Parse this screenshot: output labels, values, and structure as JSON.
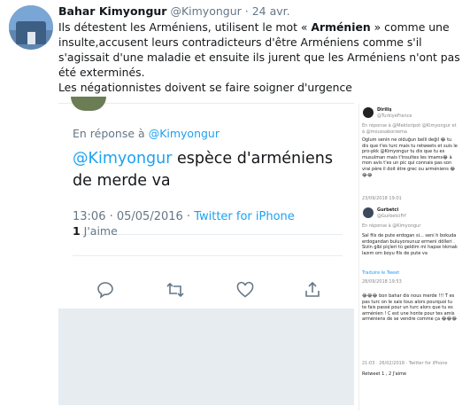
{
  "tweet": {
    "display_name": "Bahar Kimyongur",
    "handle": "@Kimyongur",
    "separator": "·",
    "date": "24 avr.",
    "text_part1": "Ils détestent les Arméniens, utilisent le mot « ",
    "text_bold": "Arménien",
    "text_part2": " » comme une insulte,accusent leurs contradicteurs d'être Arméniens comme s'il s'agissait d'une maladie et ensuite ils jurent que les Arméniens n'ont pas été exterminés.",
    "text_line2": "Les négationnistes doivent se faire soigner d'urgence"
  },
  "embedded": {
    "reply_prefix": "En réponse à",
    "reply_mention": "@Kimyongur",
    "body_mention": "@Kimyongur",
    "body_text": " espèce d'arméniens de merde va",
    "time": "13:06 · 05/05/2016 · ",
    "source": "Twitter for iPhone",
    "likes_count": "1",
    "likes_label": " J'aime",
    "actions": [
      "reply-icon",
      "retweet-icon",
      "like-icon",
      "share-icon"
    ]
  },
  "screenshot": {
    "user1_name": "Diriliş",
    "user1_handle": "@TurkiyeFrance",
    "user1_reply": "En réponse à @Mektoripot @Kimyongur et à @moussaborzema",
    "user1_text": "Oglum senin ne olduğun belli değil 😂 tu dis que t'es turc mais tu retweets et suis le pro-pkk @Kimyongur tu dis que tu es musulman mais t'insultes les imams😂 à mon avis t'es un pic qui connais pas son vrai père il doit être grec ou arméniens 😂😂😂",
    "user1_date": "23/09/2018 19:01",
    "user2_name": "Gurbetci",
    "user2_handle": "@GurbetciFrf",
    "user2_reply": "En réponse à @Kimyongur",
    "user2_text": "Sal fils de pute erdogan si... seni h bokuda erdogandan buluyorsunuz ermeni dölleri . Sizin gibi piçleri tü geldim mi hapse tıkmak lazım om boyu fils de pute va",
    "user2_translate": "Traduire le Tweet",
    "user2_date": "28/09/2018 19:53",
    "user3_text": "😂😂😂 bon bahar dis nous merde !!! T es pas turc on le sais tous alors pourquoi tu te fais passé pour un turc alors que tu es arménien ! C est une honte pour tes amis arméniens de se vendre comme ça 😂😂😂",
    "user3_meta": "21:03 · 26/02/2018 · Twitter for iPhone",
    "user3_stats": "Retweet 1 , 2 J'aime"
  }
}
